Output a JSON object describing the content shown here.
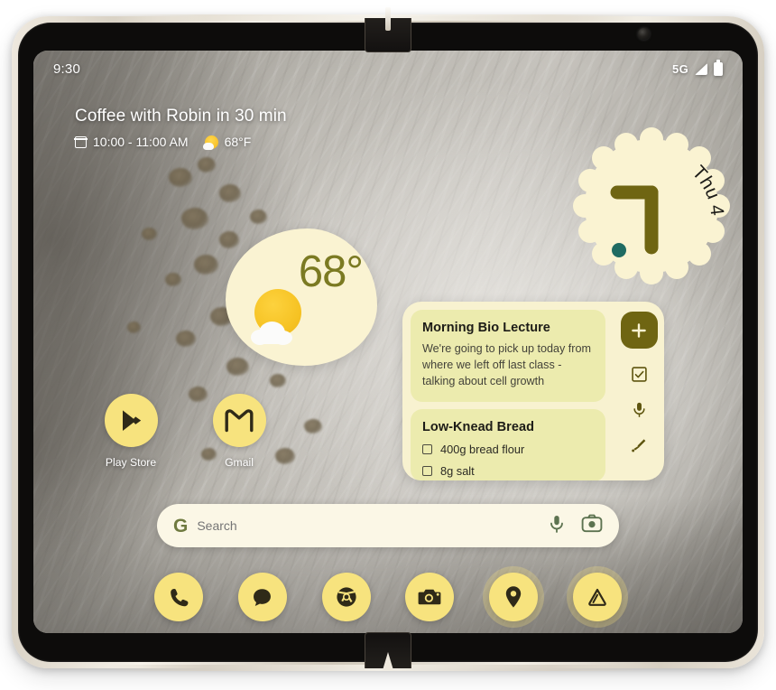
{
  "device": {
    "name": "foldable-phone",
    "camera": "front-camera"
  },
  "status_bar": {
    "time": "9:30",
    "network": "5G",
    "signal_icon": "signal-bars-icon",
    "battery_icon": "battery-icon"
  },
  "at_a_glance": {
    "title": "Coffee with Robin in 30 min",
    "calendar_icon": "calendar-icon",
    "time_range": "10:00 - 11:00 AM",
    "weather_icon": "sun-cloud-icon",
    "temperature": "68°F"
  },
  "clock_widget": {
    "name": "analog-clock-widget",
    "date_label": "Thu 4",
    "hour": 9,
    "minute": 30,
    "hand_color": "#6f6512",
    "face_color": "#faf3d2",
    "dot_color": "#1f6b62"
  },
  "weather_widget": {
    "name": "weather-widget",
    "temperature": "68°",
    "icon": "sun-cloud-icon",
    "text_color": "#7b7a22",
    "bg_color": "#faf3d2"
  },
  "notes_widget": {
    "name": "keep-notes-widget",
    "bg_color": "#f8f2d0",
    "card_color": "#ecebae",
    "notes": [
      {
        "title": "Morning Bio Lecture",
        "body": "We're going to pick up today from where we left off last class - talking about cell growth",
        "checklist": []
      },
      {
        "title": "Low-Knead Bread",
        "body": "",
        "checklist": [
          "400g bread flour",
          "8g salt"
        ]
      }
    ],
    "actions": [
      {
        "name": "new-note-button",
        "icon": "plus-icon",
        "label": "New note"
      },
      {
        "name": "new-checklist-button",
        "icon": "checkbox-icon",
        "label": "New list"
      },
      {
        "name": "voice-note-button",
        "icon": "microphone-icon",
        "label": "Voice note"
      },
      {
        "name": "drawing-note-button",
        "icon": "brush-icon",
        "label": "Drawing"
      }
    ]
  },
  "apps": [
    {
      "name": "app-play-store",
      "label": "Play Store",
      "icon": "play-store-icon"
    },
    {
      "name": "app-gmail",
      "label": "Gmail",
      "icon": "gmail-icon"
    }
  ],
  "search": {
    "name": "google-search-bar",
    "logo": "google-g-icon",
    "placeholder": "Search",
    "value": "",
    "actions": [
      {
        "name": "voice-search-button",
        "icon": "microphone-icon"
      },
      {
        "name": "lens-search-button",
        "icon": "camera-lens-icon"
      }
    ]
  },
  "dock": [
    {
      "name": "dock-phone",
      "icon": "phone-icon",
      "label": "Phone"
    },
    {
      "name": "dock-messages",
      "icon": "message-bubble-icon",
      "label": "Messages"
    },
    {
      "name": "dock-chrome",
      "icon": "chrome-icon",
      "label": "Chrome"
    },
    {
      "name": "dock-camera",
      "icon": "camera-icon",
      "label": "Camera"
    },
    {
      "name": "dock-maps",
      "icon": "map-pin-icon",
      "label": "Maps"
    },
    {
      "name": "dock-home",
      "icon": "home-icon",
      "label": "Home"
    }
  ],
  "theme": {
    "accent_yellow": "#f7e37e",
    "accent_olive": "#6f6512",
    "cream": "#faf3d2"
  }
}
